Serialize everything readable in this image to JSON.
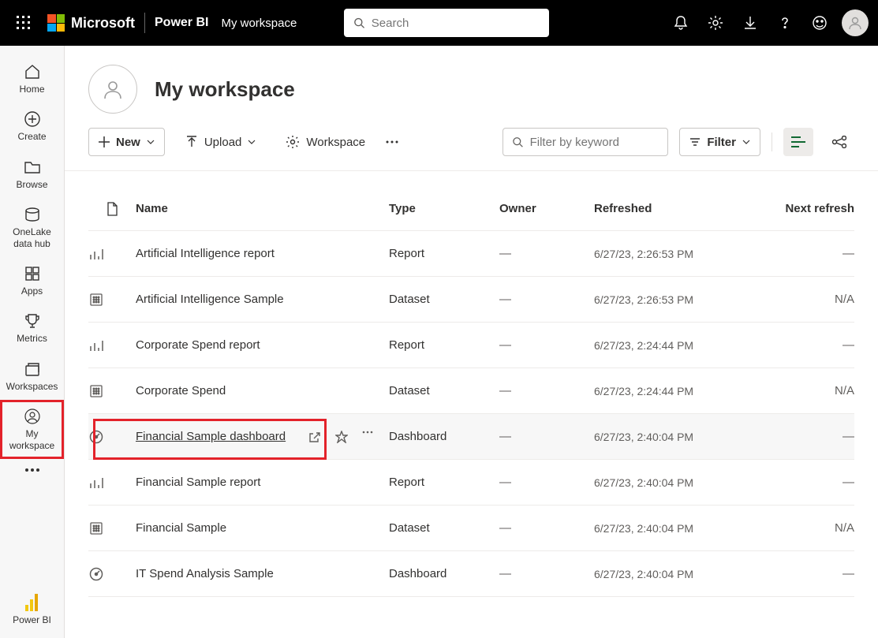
{
  "header": {
    "microsoft": "Microsoft",
    "powerbi": "Power BI",
    "workspace": "My workspace",
    "search_placeholder": "Search"
  },
  "sidebar": {
    "items": [
      {
        "label": "Home"
      },
      {
        "label": "Create"
      },
      {
        "label": "Browse"
      },
      {
        "label": "OneLake data hub"
      },
      {
        "label": "Apps"
      },
      {
        "label": "Metrics"
      },
      {
        "label": "Workspaces"
      },
      {
        "label": "My workspace"
      }
    ],
    "footer": "Power BI"
  },
  "workspace": {
    "title": "My workspace"
  },
  "toolbar": {
    "new_label": "New",
    "upload_label": "Upload",
    "settings_label": "Workspace",
    "filter_placeholder": "Filter by keyword",
    "filter_btn": "Filter"
  },
  "table": {
    "headers": {
      "name": "Name",
      "type": "Type",
      "owner": "Owner",
      "refreshed": "Refreshed",
      "next": "Next refresh"
    },
    "rows": [
      {
        "name": "Artificial Intelligence report",
        "type": "Report",
        "owner": "—",
        "refreshed": "6/27/23, 2:26:53 PM",
        "next": "—",
        "icon": "report"
      },
      {
        "name": "Artificial Intelligence Sample",
        "type": "Dataset",
        "owner": "—",
        "refreshed": "6/27/23, 2:26:53 PM",
        "next": "N/A",
        "icon": "dataset"
      },
      {
        "name": "Corporate Spend report",
        "type": "Report",
        "owner": "—",
        "refreshed": "6/27/23, 2:24:44 PM",
        "next": "—",
        "icon": "report"
      },
      {
        "name": "Corporate Spend",
        "type": "Dataset",
        "owner": "—",
        "refreshed": "6/27/23, 2:24:44 PM",
        "next": "N/A",
        "icon": "dataset"
      },
      {
        "name": "Financial Sample dashboard",
        "type": "Dashboard",
        "owner": "—",
        "refreshed": "6/27/23, 2:40:04 PM",
        "next": "—",
        "icon": "dashboard",
        "selected": true
      },
      {
        "name": "Financial Sample report",
        "type": "Report",
        "owner": "—",
        "refreshed": "6/27/23, 2:40:04 PM",
        "next": "—",
        "icon": "report"
      },
      {
        "name": "Financial Sample",
        "type": "Dataset",
        "owner": "—",
        "refreshed": "6/27/23, 2:40:04 PM",
        "next": "N/A",
        "icon": "dataset"
      },
      {
        "name": "IT Spend Analysis Sample",
        "type": "Dashboard",
        "owner": "—",
        "refreshed": "6/27/23, 2:40:04 PM",
        "next": "—",
        "icon": "dashboard"
      }
    ]
  }
}
